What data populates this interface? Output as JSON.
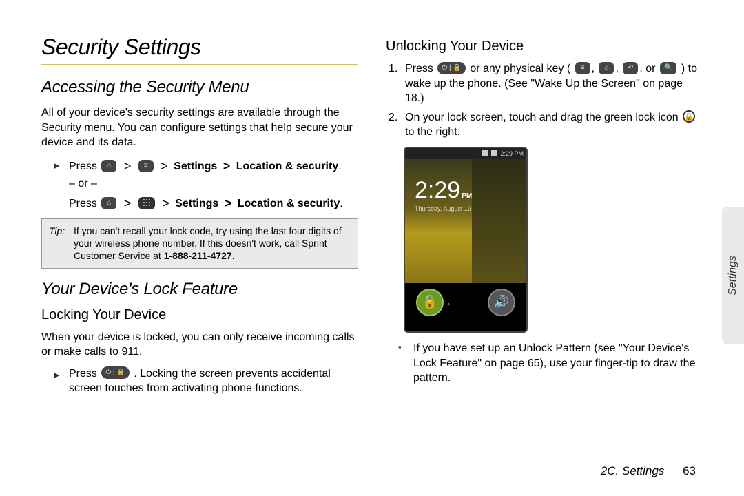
{
  "page": {
    "title": "Security Settings",
    "section_chapter": "2C. Settings",
    "page_number": "63",
    "side_tab": "Settings"
  },
  "left": {
    "h_access": "Accessing the Security Menu",
    "p_access": "All of your device's security settings are available through the Security menu. You can configure settings that help secure your device and its data.",
    "step1_prefix": "Press ",
    "nav_settings": "Settings",
    "nav_gt": ">",
    "nav_location": "Location & security",
    "or": "– or –",
    "tip_label": "Tip:",
    "tip_text_a": "If you can't recall your lock code, try using the last four digits of your wireless phone number. If this doesn't work, call Sprint Customer Service at ",
    "tip_phone": "1-888-211-4727",
    "h_lock": "Your Device's Lock Feature",
    "h_locking": "Locking Your Device",
    "p_locking": "When your device is locked, you can only receive incoming calls or make calls to 911.",
    "step_lock_a": "Press ",
    "step_lock_b": ". Locking the screen prevents accidental screen touches from activating phone functions."
  },
  "right": {
    "h_unlock": "Unlocking Your Device",
    "s1_a": "Press ",
    "s1_b": " or any physical key ( ",
    "s1_c": " ) to wake up the phone. (See \"Wake Up the Screen\" on page 18.)",
    "s2_a": "On your lock screen, touch and drag the green lock icon ",
    "s2_b": " to the right.",
    "clock_time": "2:29",
    "clock_pm": "PM",
    "clock_date": "Thursday, August 19",
    "status_time": "2:29 PM",
    "note_a": "If you have set up an Unlock Pattern (see \"Your Device's Lock Feature\" on page 65), use your finger-tip to draw the pattern."
  },
  "keys": {
    "home": "⌂",
    "menu": "≡",
    "power": "⏻ | 🔒",
    "back": "↶",
    "search": "🔍",
    "comma": ", ",
    "or_word": "or"
  }
}
